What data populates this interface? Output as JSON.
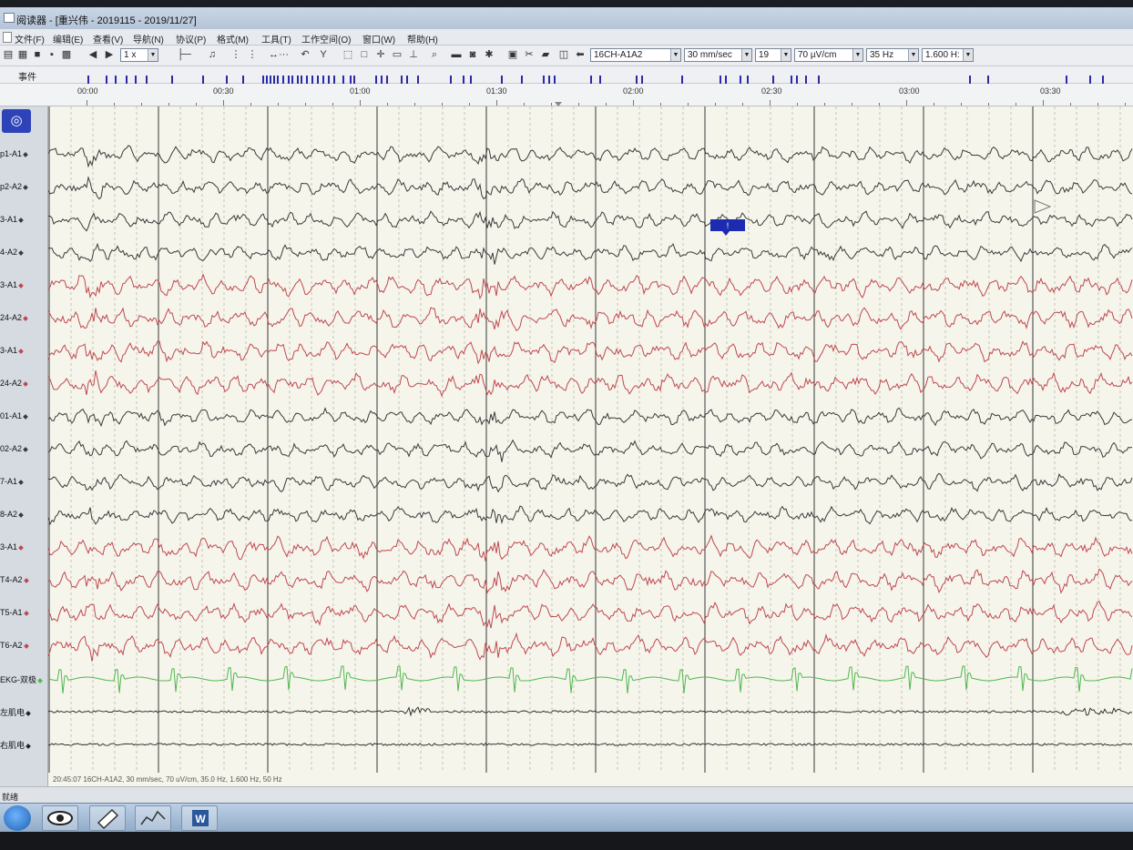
{
  "window": {
    "title": "阅读器 - [重兴伟 - 2019115 - 2019/11/27]"
  },
  "menu": [
    "文件(F)",
    "编辑(E)",
    "查看(V)",
    "导航(N)",
    "协议(P)",
    "格式(M)",
    "工具(T)",
    "工作空间(O)",
    "窗口(W)",
    "帮助(H)"
  ],
  "toolbar": {
    "playback_speed": "1 x",
    "montage": "16CH-A1A2",
    "paper_speed": "30 mm/sec",
    "channel_count": "19",
    "sensitivity": "70 µV/cm",
    "high_filter": "35 Hz",
    "low_filter": "1.600 H:"
  },
  "events": {
    "label": "事件"
  },
  "timeline": {
    "labels": [
      "00:00",
      "00:30",
      "01:00",
      "01:30",
      "02:00",
      "02:30",
      "03:00",
      "03:30"
    ]
  },
  "channels": [
    {
      "label": "p1-A1",
      "color": "#3a3a3a"
    },
    {
      "label": "p2-A2",
      "color": "#3a3a3a"
    },
    {
      "label": "3-A1",
      "color": "#3a3a3a"
    },
    {
      "label": "4-A2",
      "color": "#3a3a3a"
    },
    {
      "label": "3-A1",
      "color": "#c0484e"
    },
    {
      "label": "24-A2",
      "color": "#c0484e"
    },
    {
      "label": "3-A1",
      "color": "#c0484e"
    },
    {
      "label": "24-A2",
      "color": "#c0484e"
    },
    {
      "label": "01-A1",
      "color": "#3a3a3a"
    },
    {
      "label": "02-A2",
      "color": "#3a3a3a"
    },
    {
      "label": "7-A1",
      "color": "#3a3a3a"
    },
    {
      "label": "8-A2",
      "color": "#3a3a3a"
    },
    {
      "label": "3-A1",
      "color": "#c0484e"
    },
    {
      "label": "T4-A2",
      "color": "#c0484e"
    },
    {
      "label": "T5-A1",
      "color": "#c0484e"
    },
    {
      "label": "T6-A2",
      "color": "#c0484e"
    },
    {
      "label": "EKG-双极",
      "color": "#52b64e"
    },
    {
      "label": "左肌电",
      "color": "#222222"
    },
    {
      "label": "右肌电",
      "color": "#222222"
    }
  ],
  "annotation": {
    "text": "!"
  },
  "footer": {
    "info": "20:45:07 16CH-A1A2, 30 mm/sec, 70 uV/cm, 35.0 Hz, 1.600 Hz, 50 Hz"
  },
  "status": {
    "text": "就绪"
  },
  "colors": {
    "eeg_black": "#3a3a3a",
    "eeg_red": "#c0484e",
    "ekg_green": "#52b64e",
    "event_blue": "#2a2aa8",
    "accent": "#2f43b8"
  }
}
